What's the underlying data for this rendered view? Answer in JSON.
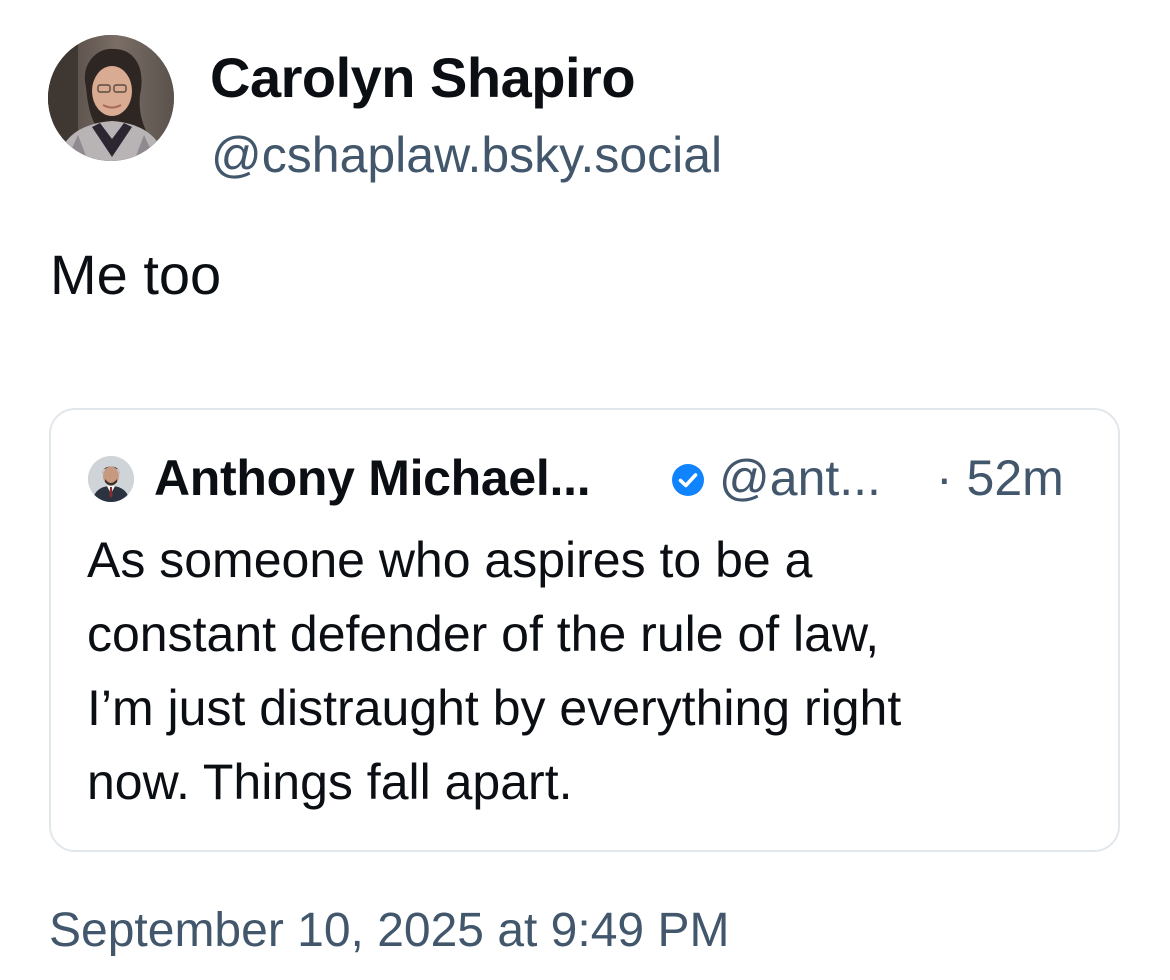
{
  "post": {
    "author": {
      "display_name": "Carolyn Shapiro",
      "handle": "@cshaplaw.bsky.social"
    },
    "text": "Me too",
    "timestamp": "September 10, 2025 at 9:49 PM"
  },
  "quoted_post": {
    "author": {
      "display_name": "Anthony Michael...",
      "handle": "@ant...",
      "verified": true
    },
    "time": "· 52m",
    "text_lines": [
      "As someone who aspires to be a",
      "constant defender of the rule of law,",
      "I’m just distraught by everything right",
      "now. Things fall apart."
    ]
  },
  "icons": {
    "verified": "verified-check-icon"
  },
  "colors": {
    "text": "#0b0f14",
    "secondary_text": "#42576c",
    "verified_badge": "#1083fe",
    "card_border": "#e2e7ec",
    "background": "#ffffff"
  }
}
